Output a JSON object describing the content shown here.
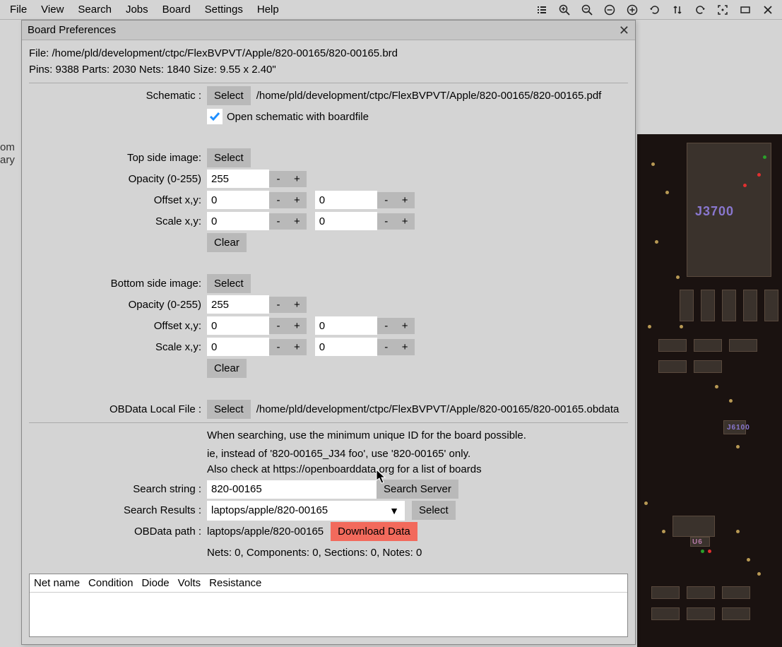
{
  "menu": {
    "file": "File",
    "view": "View",
    "search": "Search",
    "jobs": "Jobs",
    "board": "Board",
    "settings": "Settings",
    "help": "Help"
  },
  "bg_snip": {
    "l1": "om",
    "l2": "ary"
  },
  "dialog": {
    "title": "Board Preferences",
    "file_label": "File: ",
    "file_path": "/home/pld/development/ctpc/FlexBVPVT/Apple/820-00165/820-00165.brd",
    "stats": "Pins: 9388  Parts: 2030  Nets: 1840  Size: 9.55 x 2.40\"",
    "schematic": {
      "label": "Schematic :",
      "select": "Select",
      "path": "/home/pld/development/ctpc/FlexBVPVT/Apple/820-00165/820-00165.pdf",
      "open_check": "Open schematic with boardfile"
    },
    "top": {
      "label": "Top side image:",
      "select": "Select",
      "opacity_label": "Opacity (0-255)",
      "opacity": "255",
      "offset_label": "Offset x,y:",
      "ox": "0",
      "oy": "0",
      "scale_label": "Scale x,y:",
      "sx": "0",
      "sy": "0",
      "clear": "Clear"
    },
    "bottom": {
      "label": "Bottom side image:",
      "select": "Select",
      "opacity_label": "Opacity (0-255)",
      "opacity": "255",
      "offset_label": "Offset x,y:",
      "ox": "0",
      "oy": "0",
      "scale_label": "Scale x,y:",
      "sx": "0",
      "sy": "0",
      "clear": "Clear"
    },
    "minus": "-",
    "plus": "+",
    "obdata": {
      "label": "OBData Local File :",
      "select": "Select",
      "path": "/home/pld/development/ctpc/FlexBVPVT/Apple/820-00165/820-00165.obdata"
    },
    "hint1": "When searching, use the minimum unique ID for the board possible.",
    "hint2": "ie, instead of '820-00165_J34 foo', use '820-00165' only.",
    "hint3": "Also check at https://openboarddata.org for a list of boards",
    "search": {
      "label": "Search string :",
      "value": "820-00165",
      "btn": "Search Server",
      "results_label": "Search Results :",
      "selected": "laptops/apple/820-00165",
      "select_btn": "Select",
      "path_label": "OBData path :",
      "path": "laptops/apple/820-00165",
      "download": "Download Data"
    },
    "summary": "Nets: 0, Components: 0, Sections: 0, Notes: 0",
    "table": {
      "c1": "Net name",
      "c2": "Condition",
      "c3": "Diode",
      "c4": "Volts",
      "c5": "Resistance"
    }
  },
  "pcb": {
    "j3700": "J3700",
    "j6100": "J6100",
    "u6": "U6"
  }
}
